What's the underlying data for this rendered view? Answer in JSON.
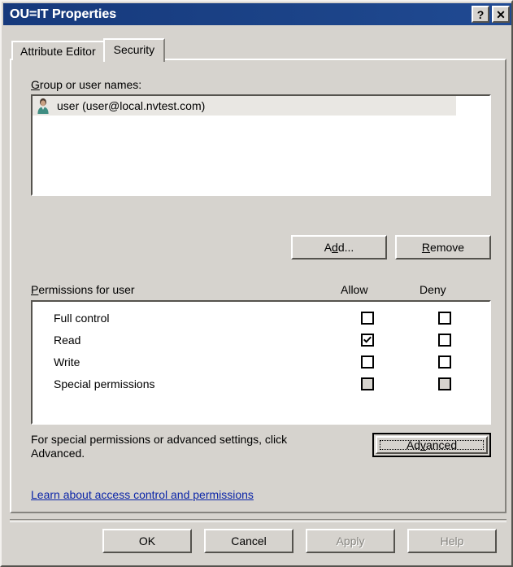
{
  "window": {
    "title": "OU=IT Properties",
    "help_button": "?",
    "close_button": "✕"
  },
  "tabs": [
    {
      "label": "Attribute Editor",
      "active": false
    },
    {
      "label": "Security",
      "active": true
    }
  ],
  "security": {
    "group_label": "Group or user names:",
    "group_label_accel": "G",
    "users": [
      {
        "name": "user (user@local.nvtest.com)",
        "selected": true,
        "icon": "user-icon"
      }
    ],
    "add_button": "Add...",
    "remove_button": "Remove",
    "permissions_label": "Permissions for user",
    "permissions_label_accel": "P",
    "columns": [
      "Allow",
      "Deny"
    ],
    "permissions": [
      {
        "name": "Full control",
        "allow": false,
        "deny": false,
        "enabled": true
      },
      {
        "name": "Read",
        "allow": true,
        "deny": false,
        "enabled": true
      },
      {
        "name": "Write",
        "allow": false,
        "deny": false,
        "enabled": true
      },
      {
        "name": "Special permissions",
        "allow": false,
        "deny": false,
        "enabled": false
      }
    ],
    "advanced_note_line1": "For special permissions or advanced settings, click",
    "advanced_note_line2": "Advanced.",
    "advanced_button": "Advanced",
    "learn_link": "Learn about access control and permissions"
  },
  "footer": {
    "ok": "OK",
    "cancel": "Cancel",
    "apply": "Apply",
    "help": "Help"
  },
  "colors": {
    "title_bar": "#16397c",
    "dialog_face": "#d6d3ce",
    "link": "#0b25a8",
    "selection": "#e9e7e3",
    "disabled_text": "#85837e"
  }
}
